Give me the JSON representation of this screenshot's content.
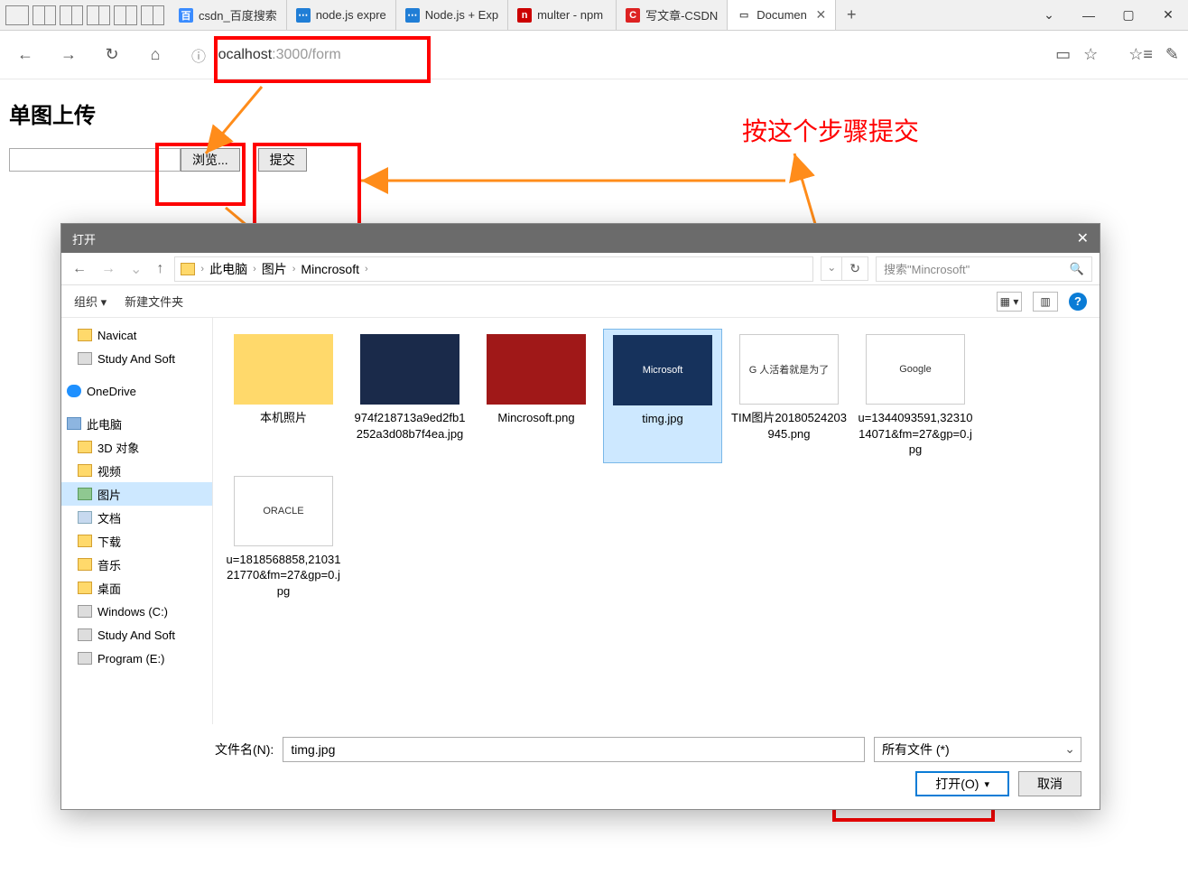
{
  "tabs": [
    {
      "label": "csdn_百度搜索",
      "icon_bg": "#3b8cff",
      "icon_fg": "#fff",
      "icon_txt": "百"
    },
    {
      "label": "node.js expre",
      "icon_bg": "#207ed6",
      "icon_fg": "#fff",
      "icon_txt": "⋯"
    },
    {
      "label": "Node.js + Exp",
      "icon_bg": "#207ed6",
      "icon_fg": "#fff",
      "icon_txt": "⋯"
    },
    {
      "label": "multer - npm",
      "icon_bg": "#cc0000",
      "icon_fg": "#fff",
      "icon_txt": "n"
    },
    {
      "label": "写文章-CSDN",
      "icon_bg": "#d22",
      "icon_fg": "#fff",
      "icon_txt": "C"
    },
    {
      "label": "Documen",
      "icon_bg": "#fff",
      "icon_fg": "#555",
      "icon_txt": "▭",
      "active": true
    }
  ],
  "address": {
    "host": "localhost",
    "rest": ":3000/form"
  },
  "page": {
    "heading": "单图上传",
    "browse": "浏览...",
    "submit": "提交"
  },
  "annotation": {
    "text": "按这个步骤提交"
  },
  "dialog": {
    "title": "打开",
    "breadcrumb": [
      "此电脑",
      "图片",
      "Mincrosoft"
    ],
    "search_placeholder": "搜索\"Mincrosoft\"",
    "organize": "组织 ▾",
    "newfolder": "新建文件夹",
    "tree": [
      {
        "label": "Navicat",
        "icon": "fld",
        "indent": 18
      },
      {
        "label": "Study And Soft",
        "icon": "drv",
        "indent": 18
      },
      {
        "label": "OneDrive",
        "icon": "cloud",
        "indent": 6,
        "gap": true
      },
      {
        "label": "此电脑",
        "icon": "pc",
        "indent": 6,
        "gap": true
      },
      {
        "label": "3D 对象",
        "icon": "fld",
        "indent": 18
      },
      {
        "label": "视频",
        "icon": "fld",
        "indent": 18
      },
      {
        "label": "图片",
        "icon": "pic",
        "indent": 18,
        "active": true
      },
      {
        "label": "文档",
        "icon": "doc",
        "indent": 18
      },
      {
        "label": "下载",
        "icon": "fld",
        "indent": 18
      },
      {
        "label": "音乐",
        "icon": "fld",
        "indent": 18
      },
      {
        "label": "桌面",
        "icon": "fld",
        "indent": 18
      },
      {
        "label": "Windows (C:)",
        "icon": "drv",
        "indent": 18
      },
      {
        "label": "Study And Soft",
        "icon": "drv",
        "indent": 18
      },
      {
        "label": "Program (E:)",
        "icon": "drv",
        "indent": 18
      }
    ],
    "files": [
      {
        "name": "本机照片",
        "thumb_bg": "#ffd96b",
        "thumb_txt": ""
      },
      {
        "name": "974f218713a9ed2fb1252a3d08b7f4ea.jpg",
        "thumb_bg": "#1a2a4a",
        "thumb_txt": ""
      },
      {
        "name": "Mincrosoft.png",
        "thumb_bg": "#a01818",
        "thumb_txt": ""
      },
      {
        "name": "timg.jpg",
        "thumb_bg": "#16325c",
        "thumb_txt": "Microsoft",
        "selected": true
      },
      {
        "name": "TIM图片20180524203945.png",
        "thumb_bg": "#fff",
        "thumb_txt": "G 人活着就是为了"
      },
      {
        "name": "u=1344093591,3231014071&fm=27&gp=0.jpg",
        "thumb_bg": "#fff",
        "thumb_txt": "Google"
      },
      {
        "name": "u=1818568858,2103121770&fm=27&gp=0.jpg",
        "thumb_bg": "#fff",
        "thumb_txt": "ORACLE"
      }
    ],
    "filename_label": "文件名(N):",
    "filename_value": "timg.jpg",
    "filter": "所有文件 (*)",
    "open_btn": "打开(O)",
    "cancel_btn": "取消"
  }
}
